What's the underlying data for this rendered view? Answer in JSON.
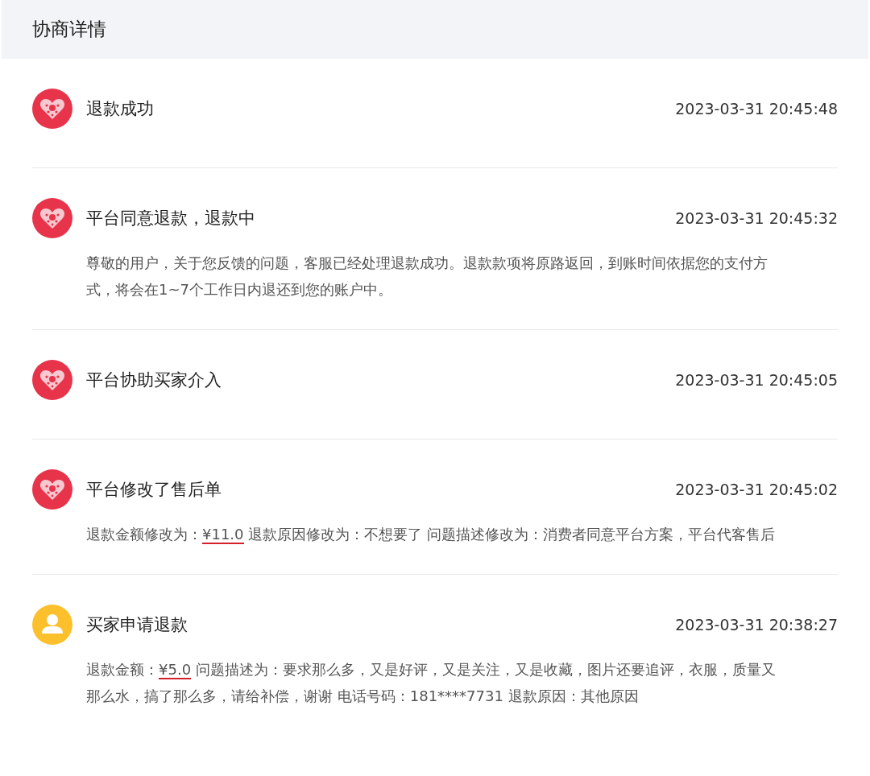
{
  "title": "协商详情",
  "events": [
    {
      "kind": "platform",
      "title": "退款成功",
      "time": "2023-03-31 20:45:48"
    },
    {
      "kind": "platform",
      "title": "平台同意退款，退款中",
      "time": "2023-03-31 20:45:32",
      "detail": [
        {
          "text": "尊敬的用户，关于您反馈的问题，客服已经处理退款成功。退款款项将原路返回，到账时间依据您的支付方式，将会在1~7个工作日内退还到您的账户中。",
          "underlined": false
        }
      ]
    },
    {
      "kind": "platform",
      "title": "平台协助买家介入",
      "time": "2023-03-31 20:45:05"
    },
    {
      "kind": "platform",
      "title": "平台修改了售后单",
      "time": "2023-03-31 20:45:02",
      "detail": [
        {
          "text": "退款金额修改为：",
          "underlined": false
        },
        {
          "text": "¥11.0",
          "underlined": true
        },
        {
          "text": " 退款原因修改为：不想要了 问题描述修改为：消费者同意平台方案，平台代客售后",
          "underlined": false
        }
      ]
    },
    {
      "kind": "buyer",
      "title": "买家申请退款",
      "time": "2023-03-31 20:38:27",
      "detail": [
        {
          "text": "退款金额：",
          "underlined": false
        },
        {
          "text": "¥5.0",
          "underlined": true
        },
        {
          "text": " 问题描述为：要求那么多，又是好评，又是关注，又是收藏，图片还要追评，衣服，质量又那么水，搞了那么多，请给补偿，谢谢 电话号码：181****7731 退款原因：其他原因",
          "underlined": false
        }
      ]
    }
  ]
}
